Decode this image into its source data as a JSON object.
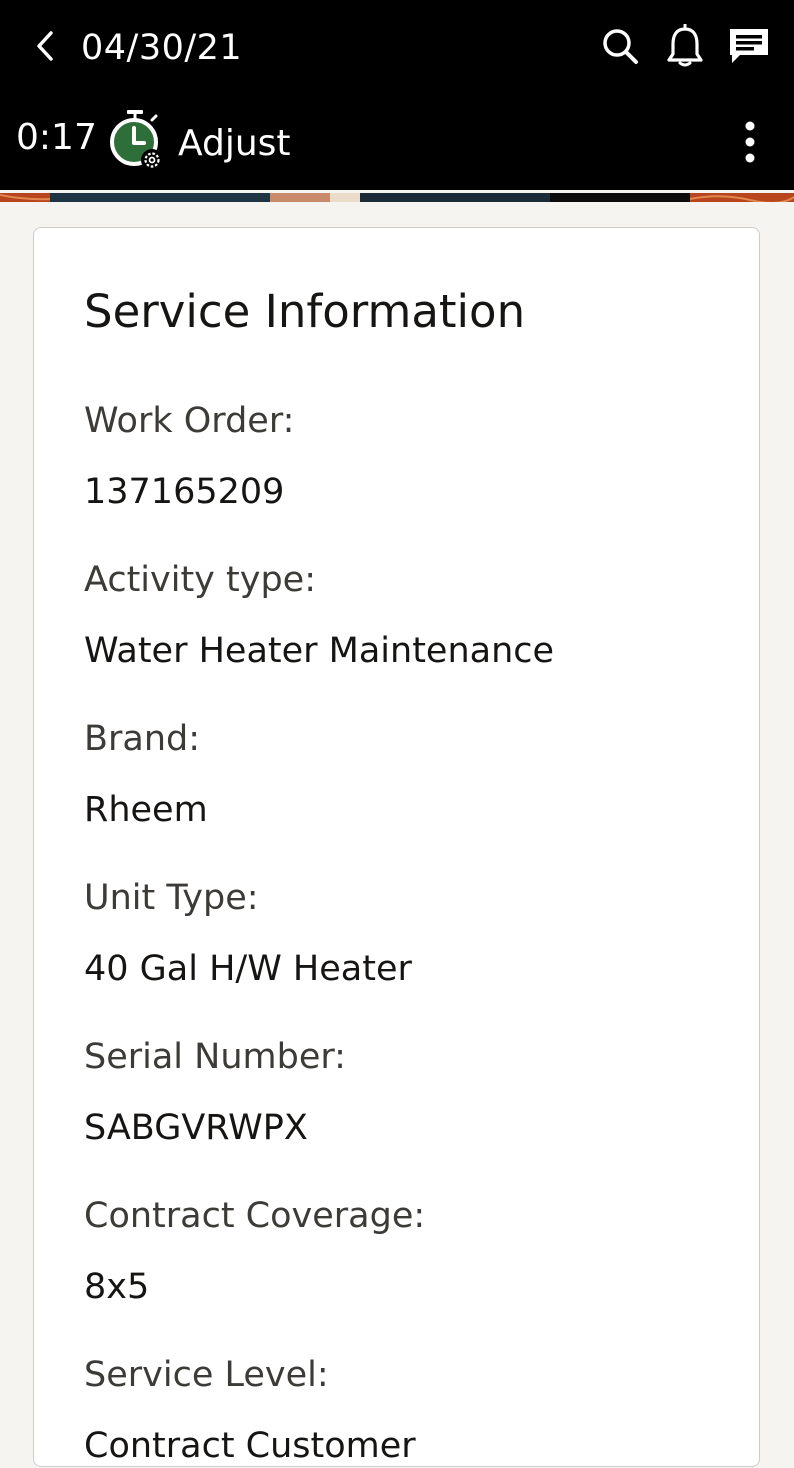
{
  "header": {
    "date": "04/30/21",
    "icons": {
      "back": "chevron-left-icon",
      "search": "search-icon",
      "notifications": "bell-icon",
      "messages": "chat-icon"
    }
  },
  "activity_bar": {
    "timer": "0:17",
    "label": "Adjust",
    "icons": {
      "timer": "stopwatch-gear-icon",
      "menu": "kebab-menu-icon"
    },
    "timer_icon_color": "#2e6e38"
  },
  "card": {
    "title": "Service Information",
    "fields": [
      {
        "label": "Work Order:",
        "value": "137165209"
      },
      {
        "label": "Activity type:",
        "value": "Water Heater Maintenance"
      },
      {
        "label": "Brand:",
        "value": "Rheem"
      },
      {
        "label": "Unit Type:",
        "value": "40 Gal H/W Heater"
      },
      {
        "label": "Serial Number:",
        "value": "SABGVRWPX"
      },
      {
        "label": "Contract Coverage:",
        "value": "8x5"
      },
      {
        "label": "Service Level:",
        "value": "Contract Customer"
      }
    ]
  },
  "colors": {
    "header_bg": "#000000",
    "page_bg": "#f6f4f1",
    "card_bg": "#ffffff",
    "label_text": "#3d3b38",
    "value_text": "#161513"
  }
}
